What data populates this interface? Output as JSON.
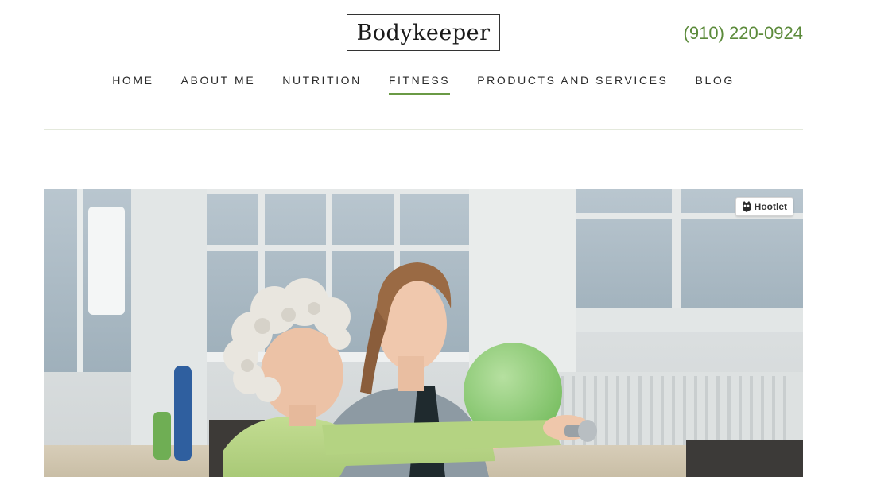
{
  "header": {
    "logo_text": "Bodykeeper",
    "phone": "(910) 220-0924"
  },
  "nav": {
    "items": [
      {
        "label": "HOME"
      },
      {
        "label": "ABOUT ME"
      },
      {
        "label": "NUTRITION"
      },
      {
        "label": "FITNESS",
        "active": true
      },
      {
        "label": "PRODUCTS AND SERVICES"
      },
      {
        "label": "BLOG"
      }
    ]
  },
  "hero": {
    "hootlet_label": "Hootlet",
    "icon": "owl-icon"
  },
  "colors": {
    "accent": "#5b8a3a",
    "active_underline": "#6a9a45",
    "divider": "#e4e9dc"
  }
}
